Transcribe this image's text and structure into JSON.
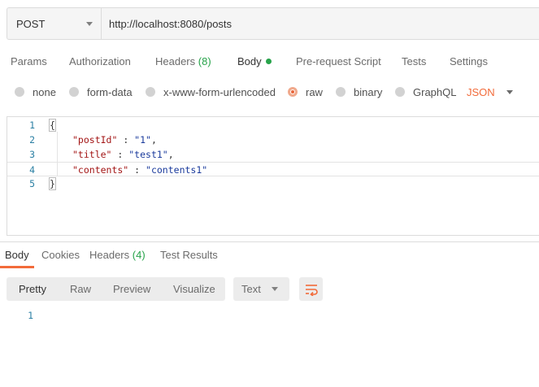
{
  "request": {
    "method": "POST",
    "url": "http://localhost:8080/posts"
  },
  "request_tabs": [
    {
      "label": "Params"
    },
    {
      "label": "Authorization"
    },
    {
      "label": "Headers",
      "count": "(8)"
    },
    {
      "label": "Body",
      "active": true,
      "indicator": "green-dot"
    },
    {
      "label": "Pre-request Script"
    },
    {
      "label": "Tests"
    },
    {
      "label": "Settings"
    }
  ],
  "body_types": [
    {
      "label": "none",
      "selected": false
    },
    {
      "label": "form-data",
      "selected": false
    },
    {
      "label": "x-www-form-urlencoded",
      "selected": false
    },
    {
      "label": "raw",
      "selected": true
    },
    {
      "label": "binary",
      "selected": false
    },
    {
      "label": "GraphQL",
      "selected": false
    }
  ],
  "raw_language": "JSON",
  "editor": {
    "line_numbers": [
      "1",
      "2",
      "3",
      "4",
      "5"
    ],
    "lines": [
      {
        "open": "{"
      },
      {
        "key": "\"postId\"",
        "sep": " : ",
        "value": "\"1\"",
        "trail": ","
      },
      {
        "key": "\"title\"",
        "sep": " : ",
        "value": "\"test1\"",
        "trail": ","
      },
      {
        "key": "\"contents\"",
        "sep": " : ",
        "value": "\"contents1\"",
        "trail": ""
      },
      {
        "close": "}"
      }
    ],
    "current_line": 4
  },
  "response_tabs": [
    {
      "label": "Body",
      "active": true
    },
    {
      "label": "Cookies"
    },
    {
      "label": "Headers",
      "count": "(4)"
    },
    {
      "label": "Test Results"
    }
  ],
  "response_views": [
    {
      "label": "Pretty",
      "active": true
    },
    {
      "label": "Raw"
    },
    {
      "label": "Preview"
    },
    {
      "label": "Visualize"
    }
  ],
  "response_format": "Text",
  "response_body": {
    "line_numbers": [
      "1"
    ]
  },
  "colors": {
    "accent": "#f26b3a",
    "success": "#27a34a",
    "line_number": "#2a7fa3"
  },
  "icons": {
    "method_dropdown": "chevron-down-icon",
    "language_dropdown": "chevron-down-icon",
    "format_dropdown": "chevron-down-icon",
    "wrap": "wrap-lines-icon"
  }
}
